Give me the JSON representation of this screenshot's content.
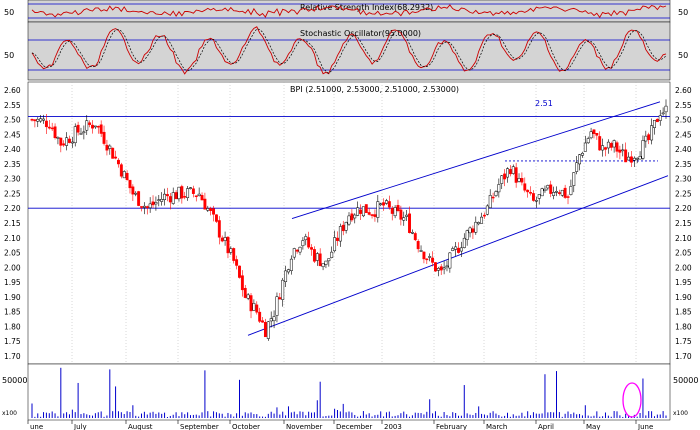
{
  "colors": {
    "panel_bg": "#d4d4d4",
    "chart_bg": "#ffffff",
    "indicator_line": "#cc0000",
    "trend_line": "#0000cc",
    "up_candle": "#000000",
    "down_candle": "#ff0000",
    "volume": "#0000cc",
    "highlight": "#ff00ff",
    "grid": "#b0b0b0"
  },
  "rsi": {
    "label": "Relative Strength Index(68.2932)",
    "tick": "50"
  },
  "stochastic": {
    "label": "Stochastic Oscillator(95.0000)",
    "tick": "50"
  },
  "price": {
    "label": "BPI (2.51000, 2.53000, 2.51000, 2.53000)",
    "annotation": "2.51"
  },
  "volume": {
    "label": "50000",
    "scale_note": "x100"
  },
  "chart_data": {
    "type": "candlestick",
    "y_ticks": [
      "2.60",
      "2.55",
      "2.50",
      "2.45",
      "2.40",
      "2.35",
      "2.30",
      "2.25",
      "2.20",
      "2.15",
      "2.10",
      "2.05",
      "2.00",
      "1.95",
      "1.90",
      "1.85",
      "1.80",
      "1.75",
      "1.70"
    ],
    "ylim": [
      1.7,
      2.6
    ],
    "x_months": [
      "June",
      "July",
      "August",
      "September",
      "October",
      "November",
      "December",
      "2003",
      "February",
      "March",
      "April",
      "May",
      "June"
    ],
    "x_months_display": [
      "une",
      "July",
      "August",
      "September",
      "October",
      "November",
      "December",
      "2003",
      "February",
      "March",
      "April",
      "May",
      "June"
    ],
    "horizontal_levels": [
      2.51,
      2.2
    ],
    "price_points": [
      [
        0,
        2.5
      ],
      [
        6,
        2.49
      ],
      [
        10,
        2.42
      ],
      [
        16,
        2.46
      ],
      [
        22,
        2.49
      ],
      [
        26,
        2.42
      ],
      [
        30,
        2.35
      ],
      [
        35,
        2.25
      ],
      [
        40,
        2.2
      ],
      [
        46,
        2.24
      ],
      [
        52,
        2.25
      ],
      [
        58,
        2.25
      ],
      [
        62,
        2.18
      ],
      [
        66,
        2.1
      ],
      [
        70,
        2.02
      ],
      [
        74,
        1.9
      ],
      [
        78,
        1.85
      ],
      [
        81,
        1.79
      ],
      [
        84,
        1.85
      ],
      [
        87,
        1.95
      ],
      [
        90,
        2.05
      ],
      [
        94,
        2.1
      ],
      [
        98,
        2.04
      ],
      [
        102,
        2.01
      ],
      [
        106,
        2.1
      ],
      [
        110,
        2.18
      ],
      [
        114,
        2.2
      ],
      [
        118,
        2.19
      ],
      [
        122,
        2.21
      ],
      [
        126,
        2.18
      ],
      [
        130,
        2.16
      ],
      [
        134,
        2.08
      ],
      [
        138,
        2.02
      ],
      [
        142,
        1.98
      ],
      [
        146,
        2.04
      ],
      [
        150,
        2.1
      ],
      [
        154,
        2.15
      ],
      [
        158,
        2.2
      ],
      [
        162,
        2.28
      ],
      [
        166,
        2.34
      ],
      [
        170,
        2.27
      ],
      [
        174,
        2.22
      ],
      [
        178,
        2.25
      ],
      [
        182,
        2.27
      ],
      [
        186,
        2.24
      ],
      [
        190,
        2.38
      ],
      [
        194,
        2.46
      ],
      [
        198,
        2.4
      ],
      [
        202,
        2.41
      ],
      [
        206,
        2.37
      ],
      [
        210,
        2.39
      ],
      [
        214,
        2.43
      ],
      [
        218,
        2.53
      ]
    ],
    "channel_upper": [
      [
        2.15,
        31.5
      ],
      [
        2.56,
        57.8
      ]
    ],
    "channel_lower": [
      [
        1.77,
        23.7
      ],
      [
        2.2,
        54.5
      ],
      [
        2.31,
        59.5
      ]
    ],
    "dashed_resistance": 2.36,
    "volume_spikes_x100": [
      100,
      150,
      130,
      140,
      100,
      120,
      160,
      170,
      150,
      130,
      120
    ]
  }
}
